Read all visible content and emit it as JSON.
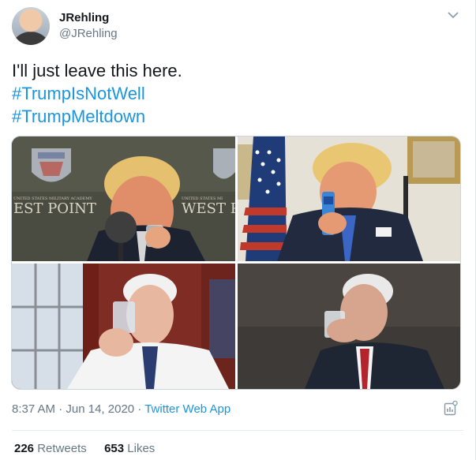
{
  "tweet": {
    "display_name": "JRehling",
    "handle": "@JRehling",
    "text_line": "I'll just leave this here.",
    "hashtags": [
      "#TrumpIsNotWell",
      "#TrumpMeltdown"
    ],
    "media_captions": {
      "t1_left": "EST POINT",
      "t1_right": "WEST P"
    },
    "time": "8:37 AM",
    "date": "Jun 14, 2020",
    "source": "Twitter Web App",
    "retweets_count": "226",
    "retweets_label": "Retweets",
    "likes_count": "653",
    "likes_label": "Likes"
  },
  "colors": {
    "link": "#1b95e0",
    "secondary_text": "#657786",
    "primary_text": "#14171a"
  },
  "icons": [
    "chevron-down-icon",
    "analytics-icon"
  ]
}
